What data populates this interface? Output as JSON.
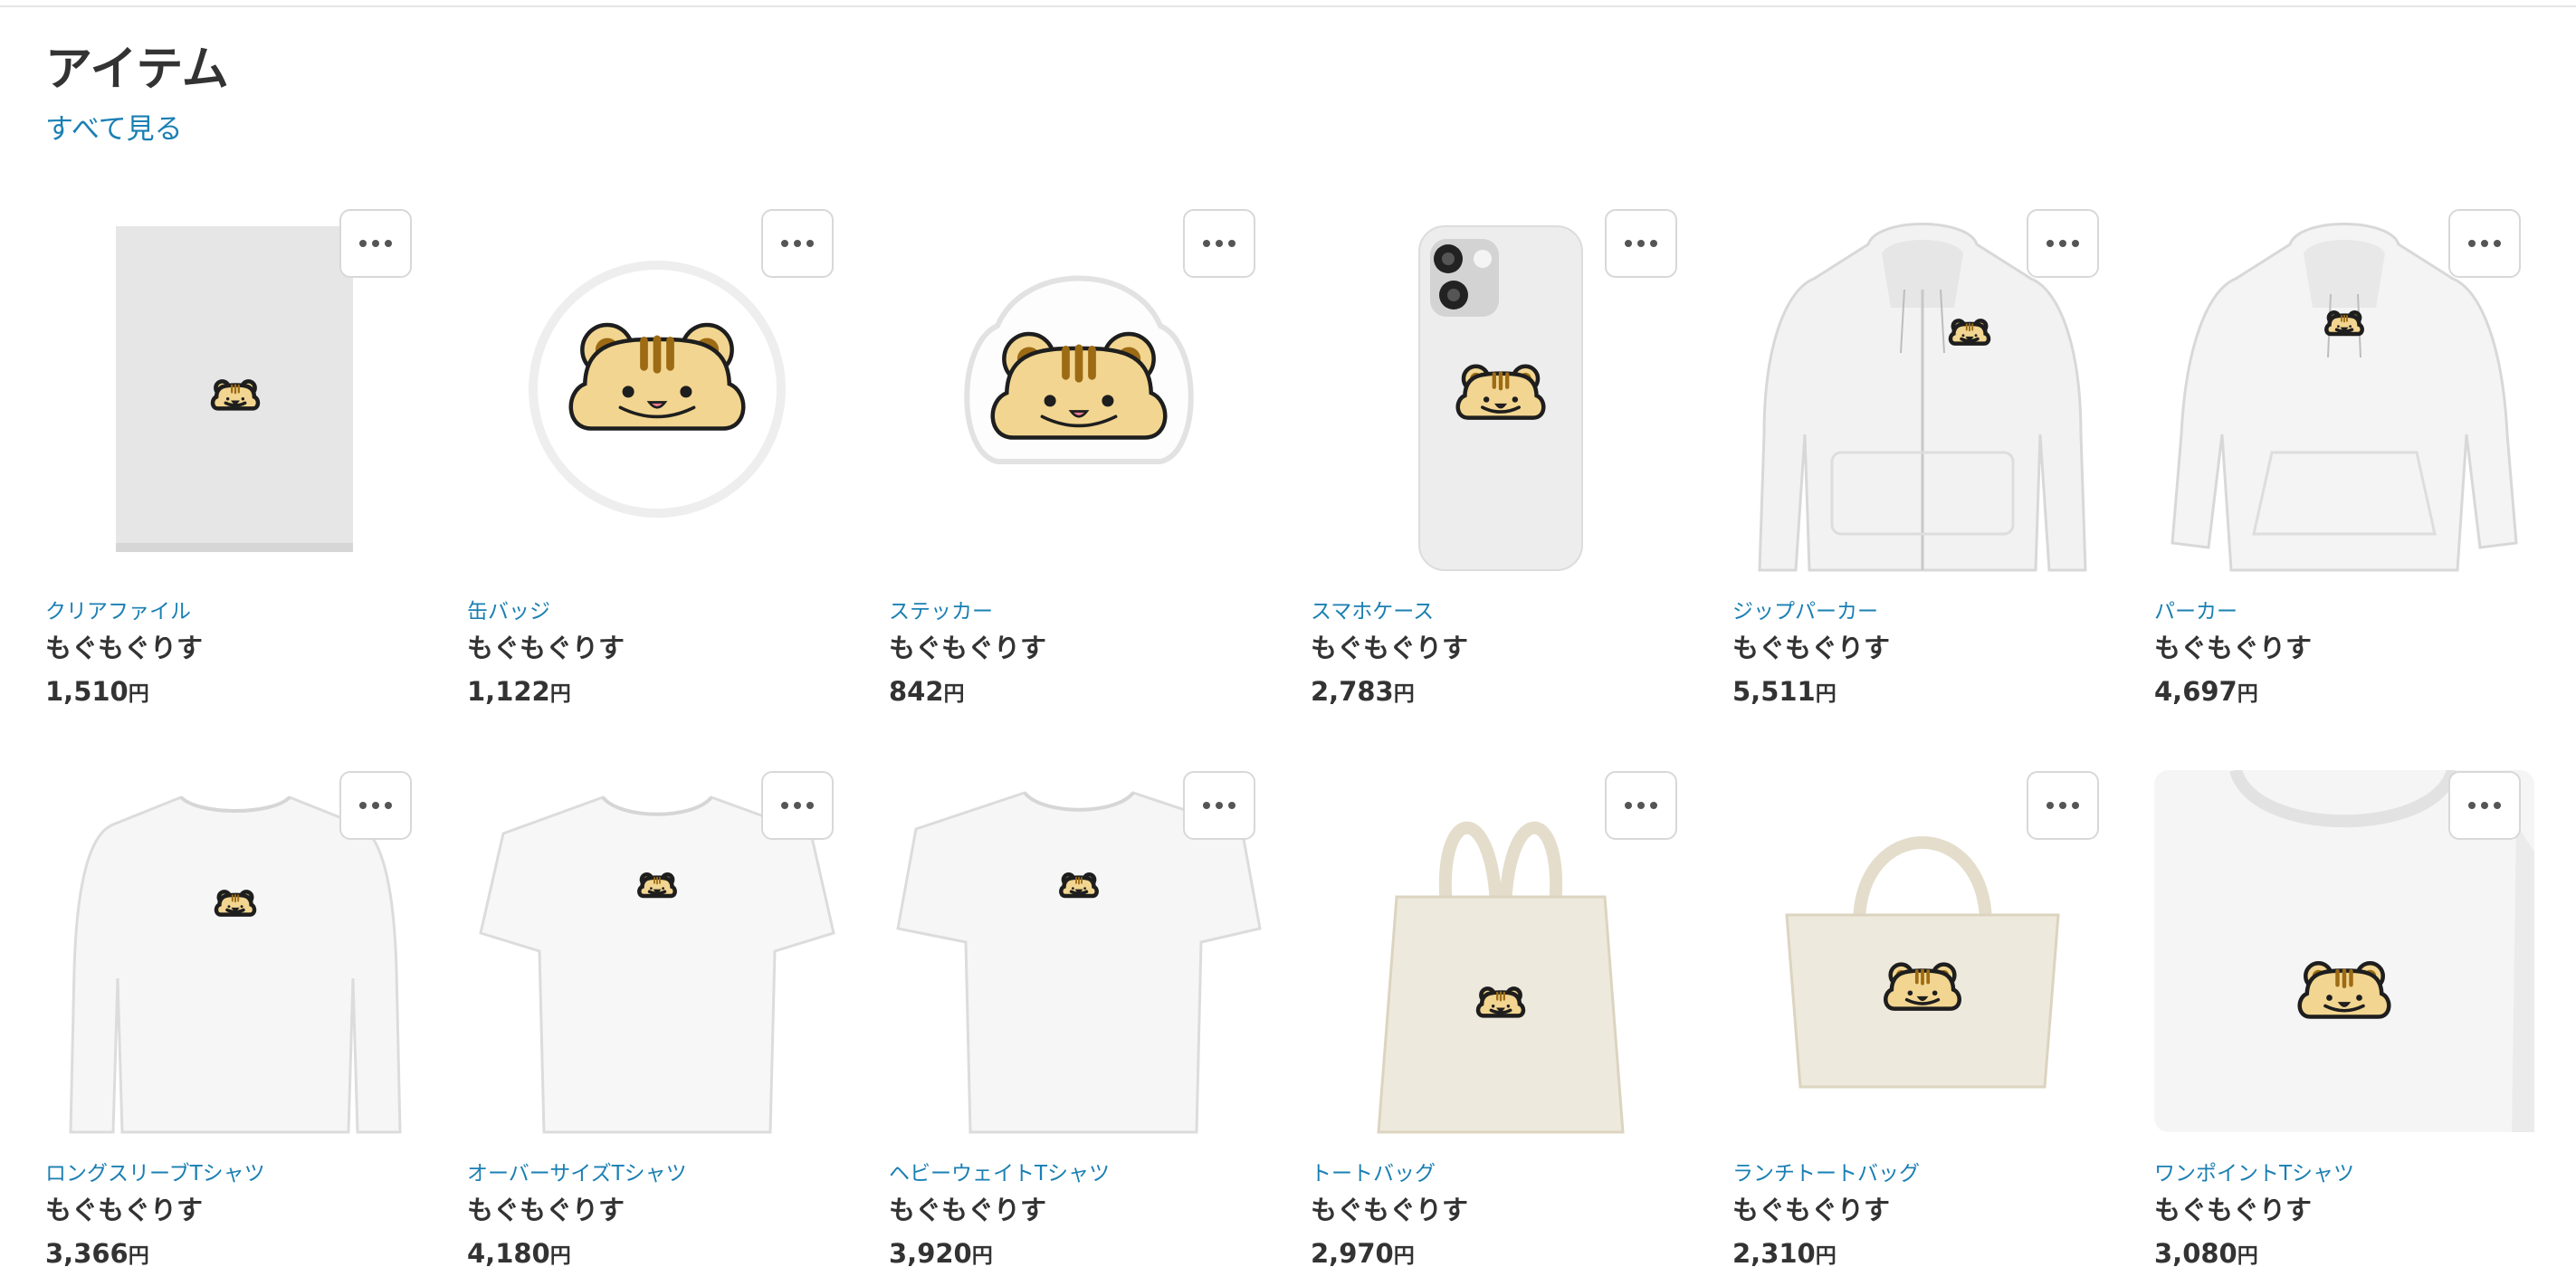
{
  "section": {
    "title": "アイテム",
    "see_all": "すべて見る"
  },
  "items": [
    {
      "category": "クリアファイル",
      "name": "もぐもぐりす",
      "price": "1,510",
      "currency": "円",
      "product": "clear-file"
    },
    {
      "category": "缶バッジ",
      "name": "もぐもぐりす",
      "price": "1,122",
      "currency": "円",
      "product": "can-badge"
    },
    {
      "category": "ステッカー",
      "name": "もぐもぐりす",
      "price": "842",
      "currency": "円",
      "product": "sticker"
    },
    {
      "category": "スマホケース",
      "name": "もぐもぐりす",
      "price": "2,783",
      "currency": "円",
      "product": "phone-case"
    },
    {
      "category": "ジップパーカー",
      "name": "もぐもぐりす",
      "price": "5,511",
      "currency": "円",
      "product": "zip-hoodie"
    },
    {
      "category": "パーカー",
      "name": "もぐもぐりす",
      "price": "4,697",
      "currency": "円",
      "product": "hoodie"
    },
    {
      "category": "ロングスリーブTシャツ",
      "name": "もぐもぐりす",
      "price": "3,366",
      "currency": "円",
      "product": "long-sleeve-tshirt"
    },
    {
      "category": "オーバーサイズTシャツ",
      "name": "もぐもぐりす",
      "price": "4,180",
      "currency": "円",
      "product": "oversize-tshirt"
    },
    {
      "category": "ヘビーウェイトTシャツ",
      "name": "もぐもぐりす",
      "price": "3,920",
      "currency": "円",
      "product": "heavyweight-tshirt"
    },
    {
      "category": "トートバッグ",
      "name": "もぐもぐりす",
      "price": "2,970",
      "currency": "円",
      "product": "tote-bag"
    },
    {
      "category": "ランチトートバッグ",
      "name": "もぐもぐりす",
      "price": "2,310",
      "currency": "円",
      "product": "lunch-tote-bag"
    },
    {
      "category": "ワンポイントTシャツ",
      "name": "もぐもぐりす",
      "price": "3,080",
      "currency": "円",
      "product": "one-point-tshirt"
    }
  ],
  "colors": {
    "link": "#1a7fb3",
    "text": "#333333",
    "character_fur": "#f2d590",
    "character_stripe": "#9c6b14",
    "character_outline": "#1e1e1e",
    "tote_canvas": "#eee9dd"
  },
  "icons": {
    "more": "more-horizontal-icon"
  }
}
